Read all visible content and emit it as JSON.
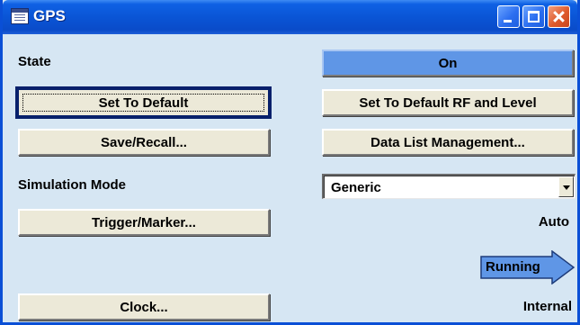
{
  "window": {
    "title": "GPS",
    "icon": "app-window-icon",
    "controls": {
      "minimize": "minimize-icon",
      "maximize": "maximize-icon",
      "close": "close-icon"
    }
  },
  "labels": {
    "state": "State",
    "simulation_mode": "Simulation Mode"
  },
  "buttons": {
    "state_value": "On",
    "set_to_default": "Set To Default",
    "set_to_default_rf": "Set To Default RF and Level",
    "save_recall": "Save/Recall...",
    "data_list_management": "Data List Management...",
    "trigger_marker": "Trigger/Marker...",
    "clock": "Clock..."
  },
  "simulation_mode": {
    "selected": "Generic"
  },
  "status": {
    "trigger_mode": "Auto",
    "running": "Running",
    "clock_source": "Internal"
  },
  "colors": {
    "title_bar": "#0a55d6",
    "panel_bg": "#d6e6f3",
    "state_on": "#5f96e6",
    "running_arrow": "#5f96e6"
  }
}
